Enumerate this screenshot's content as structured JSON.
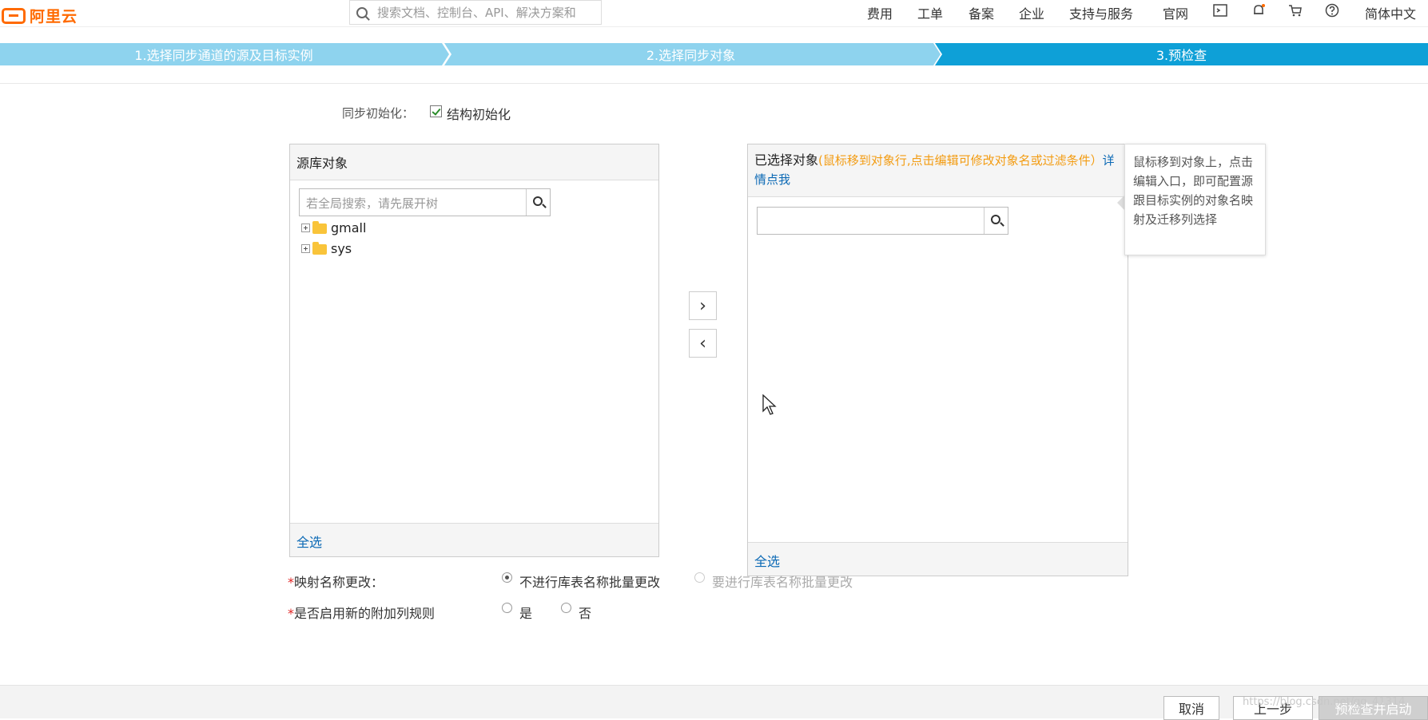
{
  "brand": {
    "logo_text": "阿里云"
  },
  "topnav": {
    "search_placeholder": "搜索文档、控制台、API、解决方案和",
    "items": [
      "费用",
      "工单",
      "备案",
      "企业",
      "支持与服务",
      "官网"
    ],
    "icons": [
      "terminal-icon",
      "bell-icon",
      "cart-icon",
      "help-icon"
    ],
    "lang": "简体中文"
  },
  "steps": [
    {
      "label": "1.选择同步通道的源及目标实例",
      "state": "done"
    },
    {
      "label": "2.选择同步对象",
      "state": "done"
    },
    {
      "label": "3.预检查",
      "state": "active"
    }
  ],
  "sync_init": {
    "label": "同步初始化：",
    "option": "结构初始化",
    "checked": true
  },
  "source_panel": {
    "title": "源库对象",
    "search_placeholder": "若全局搜索，请先展开树",
    "tree": [
      "gmall",
      "sys"
    ],
    "select_all": "全选"
  },
  "target_panel": {
    "title": "已选择对象",
    "note": "(鼠标移到对象行,点击编辑可修改对象名或过滤条件）",
    "link": "详情点我",
    "search_placeholder": "",
    "select_all": "全选"
  },
  "tooltip": {
    "text": "鼠标移到对象上，点击编辑入口，即可配置源跟目标实例的对象名映射及迁移列选择"
  },
  "options": {
    "mapping": {
      "label": "映射名称更改：",
      "choices": [
        "不进行库表名称批量更改",
        "要进行库表名称批量更改"
      ],
      "selected": 0
    },
    "extra_cols": {
      "label": "是否启用新的附加列规则",
      "choices": [
        "是",
        "否"
      ],
      "selected": null
    }
  },
  "footer": {
    "cancel": "取消",
    "prev": "上一步",
    "next": "预检查并启动"
  },
  "watermark": "https://blog.csdn.net/qq_41314"
}
